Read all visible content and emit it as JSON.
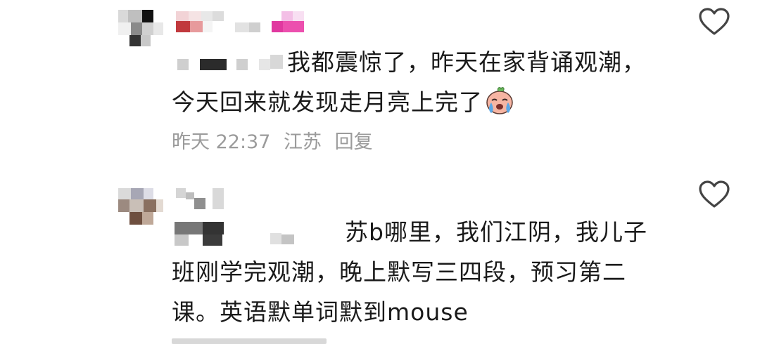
{
  "comments": [
    {
      "first_line": "我都震惊了，昨天在家背诵观潮，",
      "second_line": "今天回来就发现走月亮上完了",
      "emoji_name": "crying-emoji",
      "time": "昨天 22:37",
      "location": "江苏",
      "reply_label": "回复",
      "like_icon": "heart-outline-icon"
    },
    {
      "first_line": "苏b哪里，我们江阴，我儿子",
      "second_line": "班刚学完观潮，晚上默写三四段，预习第二",
      "third_line": "课。英语默单词默到mouse",
      "like_icon": "heart-outline-icon"
    }
  ],
  "colors": {
    "text": "#1a1a1a",
    "meta": "#9b9b9b",
    "icon": "#444444"
  }
}
